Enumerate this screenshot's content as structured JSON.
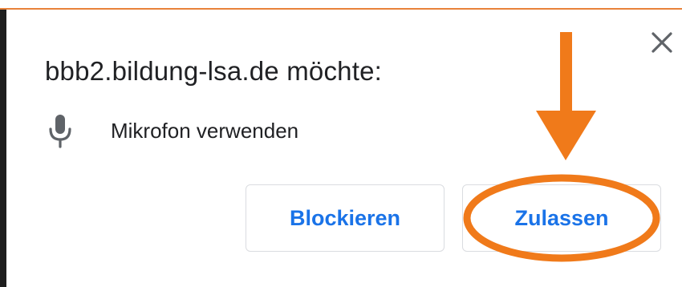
{
  "dialog": {
    "title": "bbb2.bildung-lsa.de möchte:",
    "permission_label": "Mikrofon verwenden",
    "permission_icon": "microphone-icon",
    "close_icon": "close-icon",
    "block_label": "Blockieren",
    "allow_label": "Zulassen"
  },
  "colors": {
    "accent": "#1a73e8",
    "annotation": "#f07a1a",
    "text": "#202124",
    "icon": "#5f6368"
  }
}
